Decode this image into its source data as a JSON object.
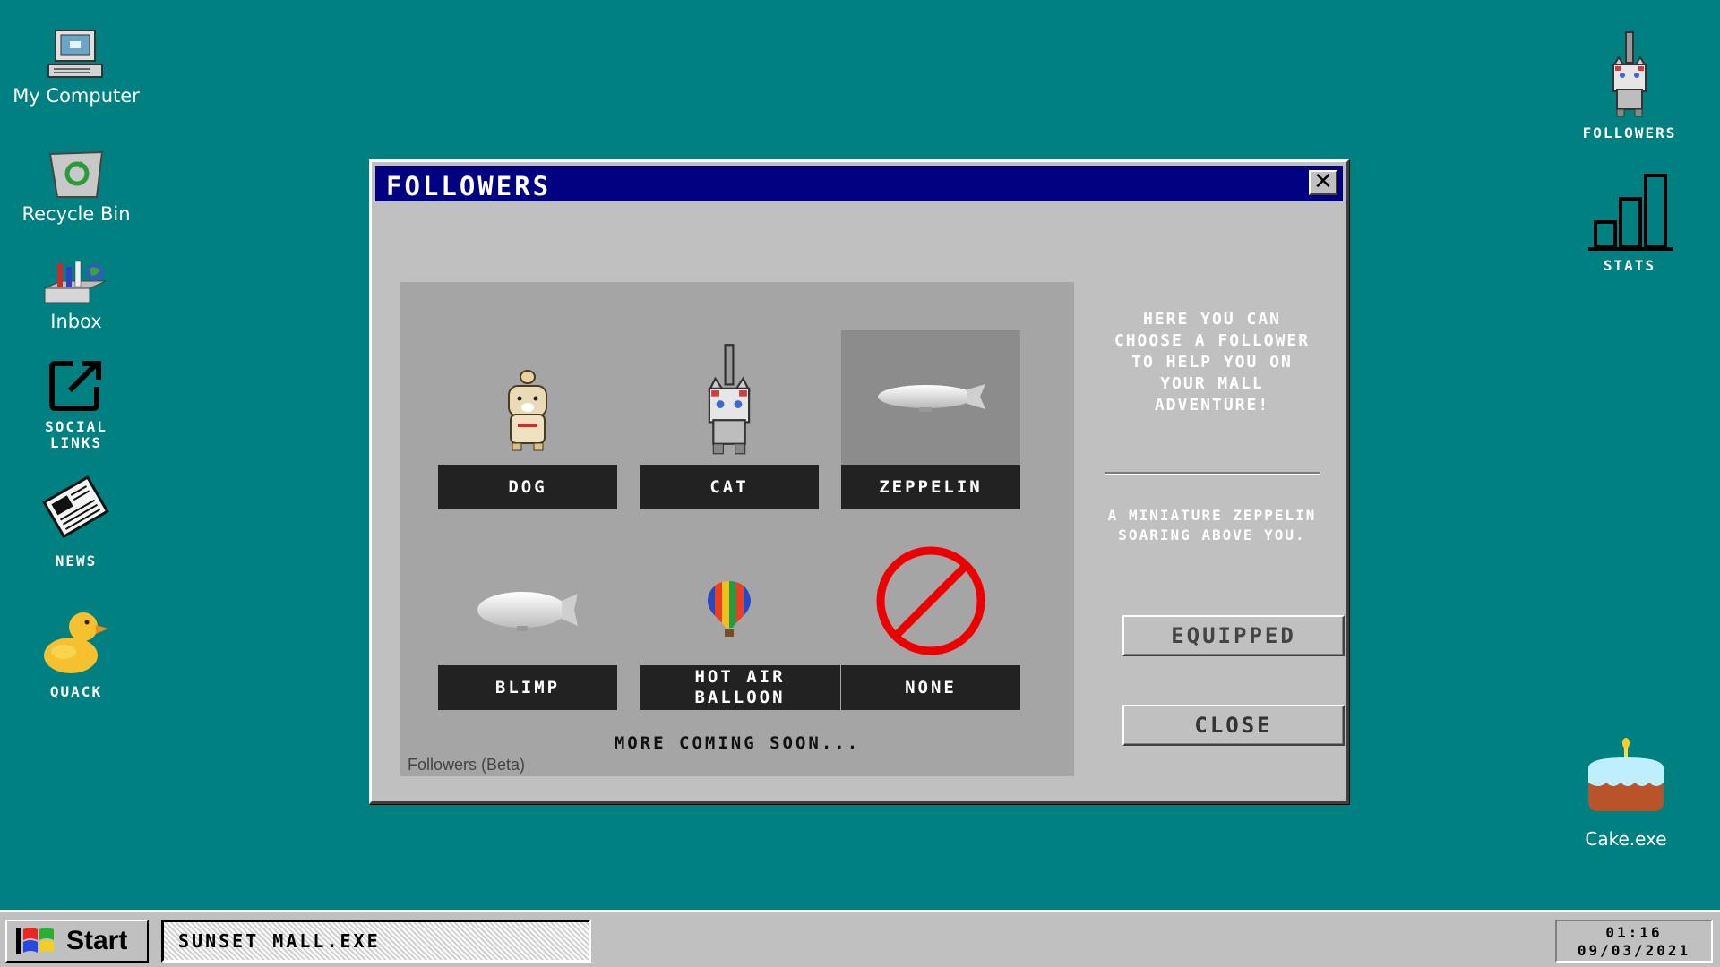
{
  "desktop": {
    "left_icons": [
      {
        "label": "My Computer"
      },
      {
        "label": "Recycle Bin"
      },
      {
        "label": "Inbox"
      },
      {
        "label": "SOCIAL\nLINKS"
      },
      {
        "label": "NEWS"
      },
      {
        "label": "QUACK"
      }
    ],
    "right_icons": [
      {
        "label": "FOLLOWERS"
      },
      {
        "label": "STATS"
      },
      {
        "label": "Cake.exe"
      }
    ]
  },
  "window": {
    "title": "FOLLOWERS",
    "close_glyph": "✕",
    "followers": [
      {
        "name": "DOG",
        "icon": "dog-icon"
      },
      {
        "name": "CAT",
        "icon": "cat-icon"
      },
      {
        "name": "ZEPPELIN",
        "icon": "zeppelin-icon",
        "selected": true
      },
      {
        "name": "BLIMP",
        "icon": "blimp-icon"
      },
      {
        "name": "HOT AIR BALLOON",
        "icon": "hot-air-balloon-icon"
      },
      {
        "name": "NONE",
        "icon": "none-icon"
      }
    ],
    "more_text": "MORE COMING SOON...",
    "beta_label": "Followers (Beta)",
    "intro_text": "HERE YOU CAN CHOOSE A FOLLOWER TO HELP YOU ON YOUR MALL ADVENTURE!",
    "description": "A MINIATURE ZEPPELIN SOARING ABOVE YOU.",
    "equipped_label": "EQUIPPED",
    "close_label": "CLOSE"
  },
  "taskbar": {
    "start_label": "Start",
    "active_task": "SUNSET MALL.EXE",
    "time": "01:16",
    "date": "09/03/2021"
  },
  "colors": {
    "desktop": "#008080",
    "titlebar": "#000080",
    "window": "#c0c0c0",
    "panel": "#a5a5a5",
    "label_bg": "#222222"
  }
}
